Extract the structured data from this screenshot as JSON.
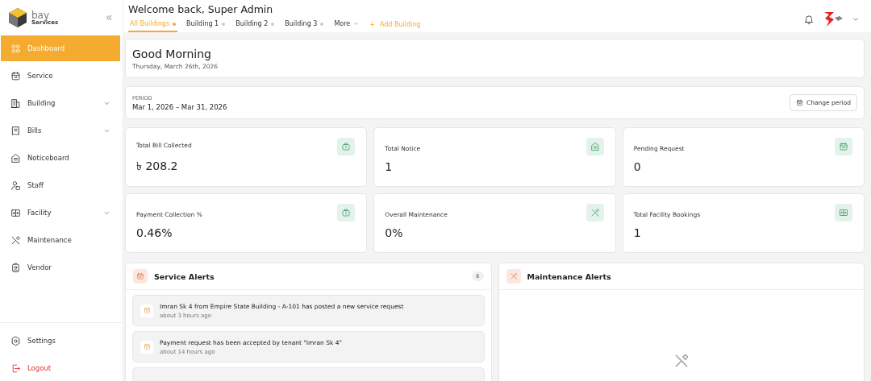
{
  "brand": {
    "name": "bay",
    "sub": "Services"
  },
  "sidebar": {
    "items": [
      {
        "label": "Dashboard",
        "selected": true,
        "expandable": false
      },
      {
        "label": "Service",
        "selected": false,
        "expandable": false
      },
      {
        "label": "Building",
        "selected": false,
        "expandable": true
      },
      {
        "label": "Bills",
        "selected": false,
        "expandable": true
      },
      {
        "label": "Noticeboard",
        "selected": false,
        "expandable": false
      },
      {
        "label": "Staff",
        "selected": false,
        "expandable": false
      },
      {
        "label": "Facility",
        "selected": false,
        "expandable": true
      },
      {
        "label": "Maintenance",
        "selected": false,
        "expandable": false
      },
      {
        "label": "Vendor",
        "selected": false,
        "expandable": false
      }
    ],
    "footer": [
      {
        "label": "Settings",
        "kind": "settings"
      },
      {
        "label": "Logout",
        "kind": "logout"
      }
    ]
  },
  "header": {
    "title": "Welcome back, Super Admin",
    "tabs": [
      {
        "label": "All Buildings",
        "selected": true,
        "kind": "building"
      },
      {
        "label": "Building 1",
        "selected": false,
        "kind": "building"
      },
      {
        "label": "Building 2",
        "selected": false,
        "kind": "building"
      },
      {
        "label": "Building 3",
        "selected": false,
        "kind": "building"
      },
      {
        "label": "More",
        "selected": false,
        "kind": "more"
      }
    ],
    "add_link": "Add Building",
    "add_icon": "+"
  },
  "greeting": {
    "title": "Good Morning",
    "date": "Thursday, March 26th, 2026"
  },
  "period": {
    "label": "PERIOD",
    "range": "Mar 1, 2026 – Mar 31, 2026",
    "button": "Change period"
  },
  "stats": [
    {
      "label": "Total Bill Collected",
      "value": "৳ 208.2"
    },
    {
      "label": "Total Notice",
      "value": "1"
    },
    {
      "label": "Pending Request",
      "value": "0"
    },
    {
      "label": "Payment Collection %",
      "value": "0.46%"
    },
    {
      "label": "Overall Maintenance",
      "value": "0%"
    },
    {
      "label": "Total Facility Bookings",
      "value": "1"
    }
  ],
  "service_alerts": {
    "title": "Service Alerts",
    "count": "6",
    "items": [
      {
        "text": "Imran Sk 4 from Empire State Building - A-101 has posted a new service request",
        "time": "about 3 hours ago"
      },
      {
        "text": "Payment request has been accepted by tenant \"Imran Sk 4\"",
        "time": "about 14 hours ago"
      }
    ]
  },
  "maintenance_alerts": {
    "title": "Maintenance Alerts"
  }
}
